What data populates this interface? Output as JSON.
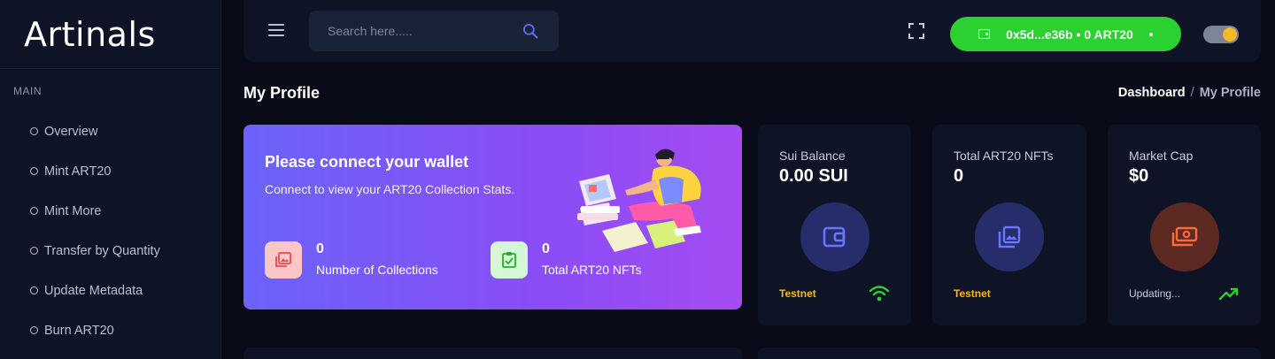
{
  "brand": {
    "name": "Artinals"
  },
  "sidebar": {
    "section": "MAIN",
    "items": [
      {
        "label": "Overview"
      },
      {
        "label": "Mint ART20"
      },
      {
        "label": "Mint More"
      },
      {
        "label": "Transfer by Quantity"
      },
      {
        "label": "Update Metadata"
      },
      {
        "label": "Burn ART20"
      }
    ]
  },
  "header": {
    "search_placeholder": "Search here.....",
    "wallet_label": "0x5d...e36b • 0 ART20",
    "colors": {
      "wallet_bg": "#2ad130",
      "toggle_knob": "#f5b72a"
    }
  },
  "page": {
    "title": "My Profile",
    "breadcrumb": {
      "home": "Dashboard",
      "separator": "/",
      "current": "My Profile"
    }
  },
  "hero": {
    "title": "Please connect your wallet",
    "subtitle": "Connect to view your ART20 Collection Stats.",
    "stats": [
      {
        "value": "0",
        "label": "Number of Collections",
        "icon": "image-gallery-icon"
      },
      {
        "value": "0",
        "label": "Total ART20 NFTs",
        "icon": "clipboard-check-icon"
      }
    ]
  },
  "cards": [
    {
      "label": "Sui Balance",
      "value": "0.00 SUI",
      "footer": "Testnet",
      "footer_color": "#f5b72a",
      "icon": "wallet-icon",
      "foot_icon": "wifi-icon"
    },
    {
      "label": "Total ART20 NFTs",
      "value": "0",
      "footer": "Testnet",
      "footer_color": "#f5b72a",
      "icon": "gallery-icon"
    },
    {
      "label": "Market Cap",
      "value": "$0",
      "footer": "Updating...",
      "footer_color": "#c6ccd9",
      "icon": "money-icon",
      "foot_icon": "trending-up-icon"
    }
  ]
}
